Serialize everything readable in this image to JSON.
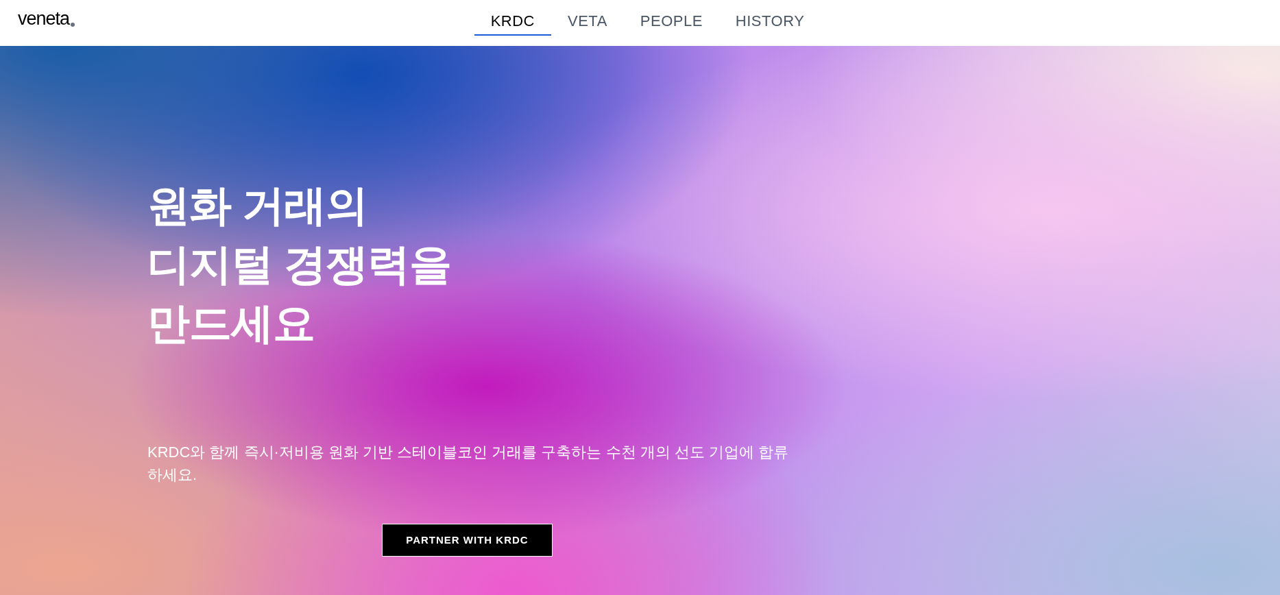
{
  "logo": "veneta",
  "nav": [
    {
      "label": "KRDC",
      "selected": true
    },
    {
      "label": "VETA",
      "selected": false
    },
    {
      "label": "PEOPLE",
      "selected": false
    },
    {
      "label": "HISTORY",
      "selected": false
    }
  ],
  "hero": {
    "headline_lines": [
      "원화 거래의",
      "디지털 경쟁력을",
      "만드세요"
    ],
    "description": "KRDC와 함께 즉시·저비용 원화 기반 스테이블코인 거래를 구축하는 수천 개의 선도 기업에 합류하세요.",
    "button": "PARTNER WITH KRDC"
  }
}
